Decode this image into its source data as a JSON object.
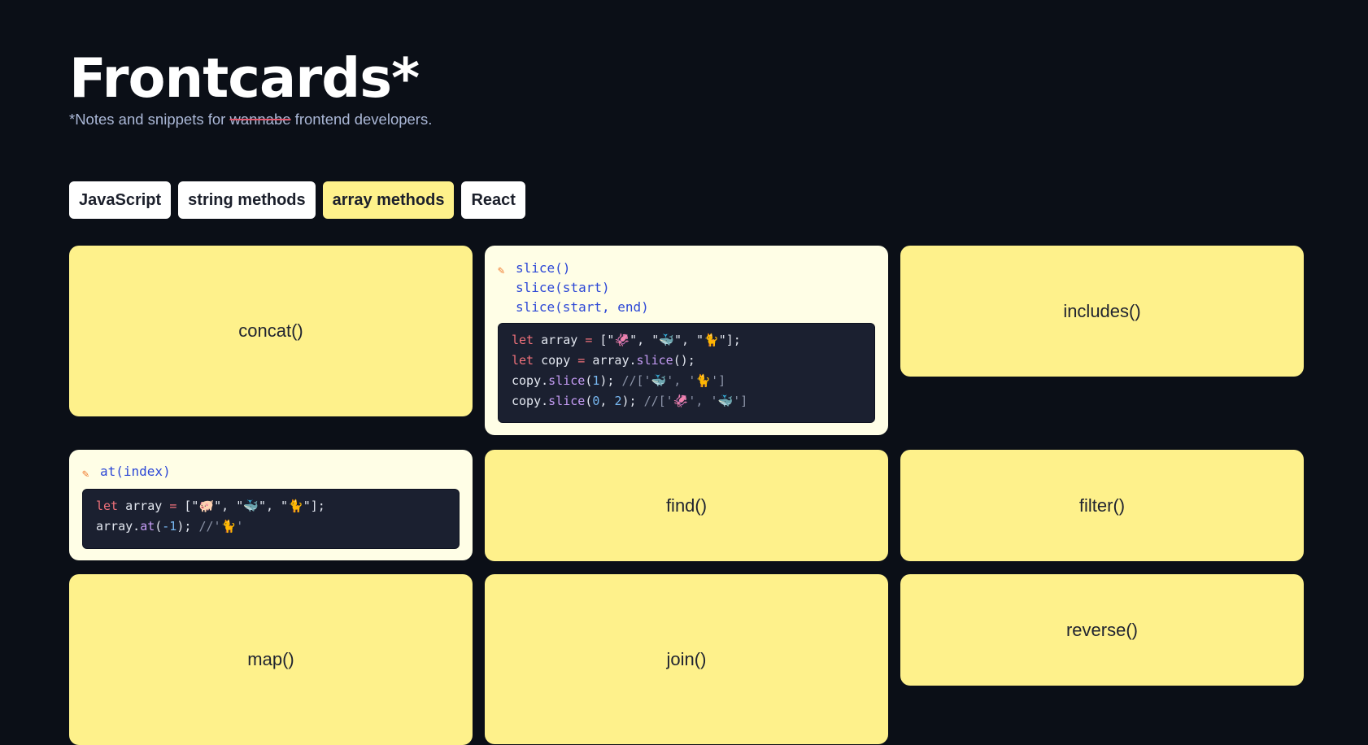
{
  "header": {
    "title": "Frontcards*",
    "subtitle_pre": "*Notes and snippets for ",
    "subtitle_strike": "wannabe",
    "subtitle_post": " frontend developers."
  },
  "tags": [
    "JavaScript",
    "string methods",
    "array methods",
    "React"
  ],
  "active_tag": "array methods",
  "cards": {
    "concat": "concat()",
    "slice": {
      "signatures": [
        "slice()",
        "slice(start)",
        "slice(start, end)"
      ],
      "code": {
        "kw": "let",
        "l1_var": " array ",
        "eq": "=",
        "l1_open": " [\"",
        "e1": "🦑",
        "sep": "\", \"",
        "e2": "🐳",
        "e3": "🐈",
        "l1_close": "\"];",
        "l2_var": " copy ",
        "l2_obj": " array.",
        "l2_fn": "slice",
        "l2_tail": "();",
        "l3_obj": "copy.",
        "l3_fn": "slice",
        "l3_open": "(",
        "l3_n1": "1",
        "l3_close": "); ",
        "l3_cm_open": "//['",
        "l3_cm_sep": "', '",
        "l3_cm_close": "']",
        "l4_obj": "copy.",
        "l4_fn": "slice",
        "l4_open": "(",
        "l4_n1": "0",
        "l4_comma": ", ",
        "l4_n2": "2",
        "l4_close": "); ",
        "l4_cm_open": "//['",
        "l4_cm_sep": "', '",
        "l4_cm_close": "']"
      }
    },
    "includes": "includes()",
    "at": {
      "signature": "at(index)",
      "code": {
        "kw": "let",
        "l1_var": " array ",
        "eq": "=",
        "l1_open": " [\"",
        "e1": "🐖",
        "sep": "\", \"",
        "e2": "🐳",
        "e3": "🐈",
        "l1_close": "\"];",
        "l2_obj": "array.",
        "l2_fn": "at",
        "l2_open": "(",
        "l2_n": "-1",
        "l2_close": "); ",
        "l2_cm_open": "//'",
        "l2_cm_close": "'"
      }
    },
    "find": "find()",
    "filter": "filter()",
    "map": "map()",
    "join": "join()",
    "reverse": "reverse()"
  },
  "colors": {
    "background": "#0b0f17",
    "card_yellow": "#fef18b",
    "card_open": "#fffee6",
    "code_bg": "#1b2030",
    "signature_blue": "#2c47d6"
  },
  "icons": {
    "edit": "pencil-icon"
  }
}
